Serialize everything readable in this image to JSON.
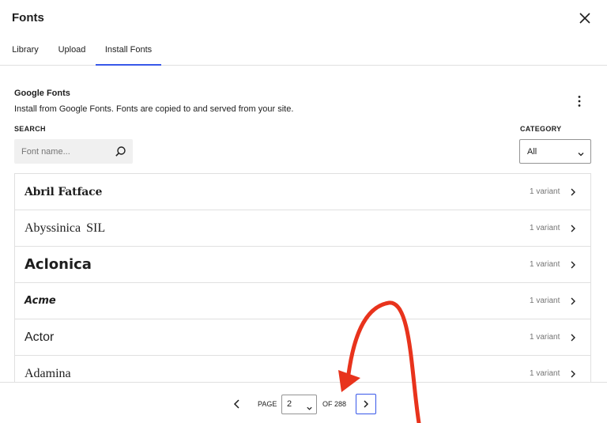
{
  "window": {
    "title": "Fonts",
    "close_icon": "close-icon"
  },
  "tabs": [
    {
      "label": "Library"
    },
    {
      "label": "Upload"
    },
    {
      "label": "Install Fonts",
      "active": true
    }
  ],
  "section": {
    "title": "Google Fonts",
    "description": "Install from Google Fonts. Fonts are copied to and served from your site.",
    "menu_icon": "more-vertical-icon"
  },
  "search": {
    "label": "SEARCH",
    "placeholder": "Font name...",
    "value": "",
    "icon": "search-icon"
  },
  "category": {
    "label": "CATEGORY",
    "value": "All"
  },
  "fonts": [
    {
      "name": "Abril Fatface",
      "variants": "1 variant"
    },
    {
      "name": "Abyssinica SIL",
      "variants": "1 variant"
    },
    {
      "name": "Aclonica",
      "variants": "1 variant"
    },
    {
      "name": "Acme",
      "variants": "1 variant"
    },
    {
      "name": "Actor",
      "variants": "1 variant"
    },
    {
      "name": "Adamina",
      "variants": "1 variant"
    }
  ],
  "pagination": {
    "page_label": "PAGE",
    "current_page": "2",
    "of_label": "OF 288"
  },
  "colors": {
    "accent": "#3858e9",
    "annotation_arrow": "#e8331c",
    "border": "#e0e0e0",
    "muted_text": "#757575"
  }
}
